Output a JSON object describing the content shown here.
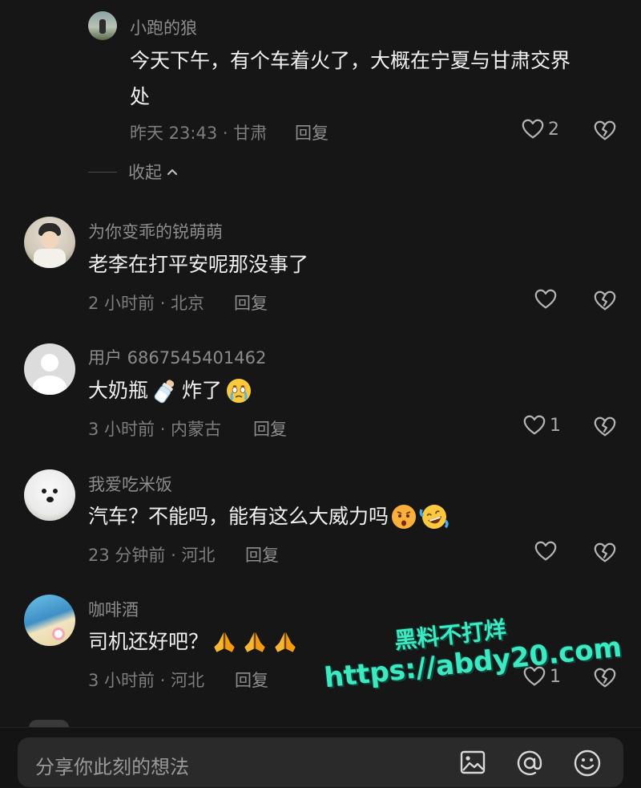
{
  "comments": [
    {
      "user": "小跑的狼",
      "text_line1": "今天下午，有个车着火了，大概在宁夏与甘肃交界",
      "text_line2": "处",
      "time": "昨天 23:43 · 甘肃",
      "reply": "回复",
      "likes": "2",
      "collapse": "收起"
    },
    {
      "user": "为你变乖的锐萌萌",
      "text": "老李在打平安呢那没事了",
      "time": "2 小时前 · 北京",
      "reply": "回复"
    },
    {
      "user": "用户 6867545401462",
      "text_before": "大奶瓶",
      "text_after": "炸了",
      "time": "3 小时前 · 内蒙古",
      "reply": "回复",
      "likes": "1"
    },
    {
      "user": "我爱吃米饭",
      "text": "汽车？不能吗，能有这么大威力吗",
      "time": "23 分钟前 · 河北",
      "reply": "回复"
    },
    {
      "user": "咖啡酒",
      "text": "司机还好吧？",
      "time": "3 小时前 · 河北",
      "reply": "回复",
      "likes": "1"
    }
  ],
  "input": {
    "placeholder": "分享你此刻的想法"
  },
  "watermark": {
    "line1": "黑料不打烊",
    "line2": "https://abdy20.com"
  },
  "colors": {
    "background": "#161616",
    "watermark": "#3ee8c1",
    "text": "#f0f0f0",
    "meta": "#7e7e7e"
  },
  "icons": [
    "heart-icon",
    "broken-heart-icon",
    "image-icon",
    "at-icon",
    "emoji-icon",
    "chevron-up-icon",
    "default-avatar-icon",
    "baby-bottle-emoji",
    "crying-face-emoji",
    "astonished-face-emoji",
    "laughing-tears-emoji",
    "praying-hands-emoji"
  ]
}
